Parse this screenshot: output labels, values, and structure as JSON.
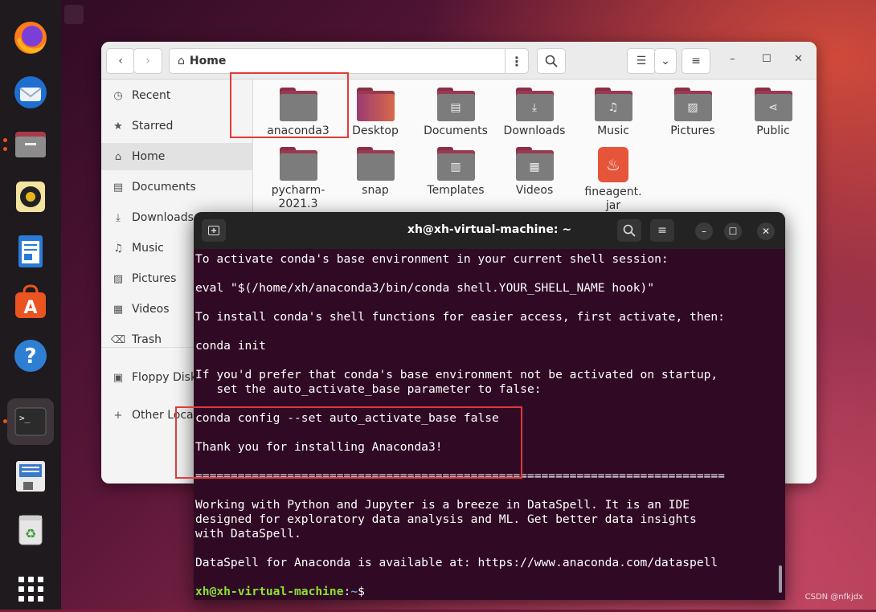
{
  "files_window": {
    "path_title": "Home",
    "sidebar": [
      {
        "icon": "recent-icon",
        "glyph": "◷",
        "label": "Recent"
      },
      {
        "icon": "star-icon",
        "glyph": "★",
        "label": "Starred"
      },
      {
        "icon": "home-icon",
        "glyph": "⌂",
        "label": "Home"
      },
      {
        "icon": "documents-icon",
        "glyph": "▤",
        "label": "Documents"
      },
      {
        "icon": "downloads-icon",
        "glyph": "⤓",
        "label": "Downloads"
      },
      {
        "icon": "music-icon",
        "glyph": "♫",
        "label": "Music"
      },
      {
        "icon": "pictures-icon",
        "glyph": "▨",
        "label": "Pictures"
      },
      {
        "icon": "videos-icon",
        "glyph": "▦",
        "label": "Videos"
      },
      {
        "icon": "trash-icon",
        "glyph": "⌫",
        "label": "Trash"
      },
      {
        "icon": "floppy-icon",
        "glyph": "▣",
        "label": "Floppy Disk"
      },
      {
        "icon": "plus-icon",
        "glyph": "+",
        "label": "Other Locations"
      }
    ],
    "items": [
      {
        "label": "anaconda3",
        "glyph": ""
      },
      {
        "label": "Desktop",
        "glyph": ""
      },
      {
        "label": "Documents",
        "glyph": "▤"
      },
      {
        "label": "Downloads",
        "glyph": "⤓"
      },
      {
        "label": "Music",
        "glyph": "♫"
      },
      {
        "label": "Pictures",
        "glyph": "▨"
      },
      {
        "label": "Public",
        "glyph": "⋖"
      },
      {
        "label": "pycharm-\n2021.3",
        "glyph": ""
      },
      {
        "label": "snap",
        "glyph": ""
      },
      {
        "label": "Templates",
        "glyph": "▥"
      },
      {
        "label": "Videos",
        "glyph": "▦"
      },
      {
        "label": "fineagent.\njar",
        "glyph": "♨"
      }
    ]
  },
  "terminal": {
    "title": "xh@xh-virtual-machine: ~",
    "lines": [
      "To activate conda's base environment in your current shell session:",
      "",
      "eval \"$(/home/xh/anaconda3/bin/conda shell.YOUR_SHELL_NAME hook)\"",
      "",
      "To install conda's shell functions for easier access, first activate, then:",
      "",
      "conda init",
      "",
      "If you'd prefer that conda's base environment not be activated on startup,",
      "   set the auto_activate_base parameter to false:",
      "",
      "conda config --set auto_activate_base false",
      "",
      "Thank you for installing Anaconda3!",
      "",
      "===========================================================================",
      "",
      "Working with Python and Jupyter is a breeze in DataSpell. It is an IDE",
      "designed for exploratory data analysis and ML. Get better data insights",
      "with DataSpell.",
      "",
      "DataSpell for Anaconda is available at: https://www.anaconda.com/dataspell",
      ""
    ],
    "prompt_user": "xh@xh-virtual-machine",
    "prompt_sep": ":",
    "prompt_path": "~",
    "prompt_symbol": "$"
  },
  "watermark": "CSDN @nfkjdx",
  "colors": {
    "accent": "#e95420",
    "terminal_bg": "#300a24",
    "highlight": "#e03a3a"
  }
}
